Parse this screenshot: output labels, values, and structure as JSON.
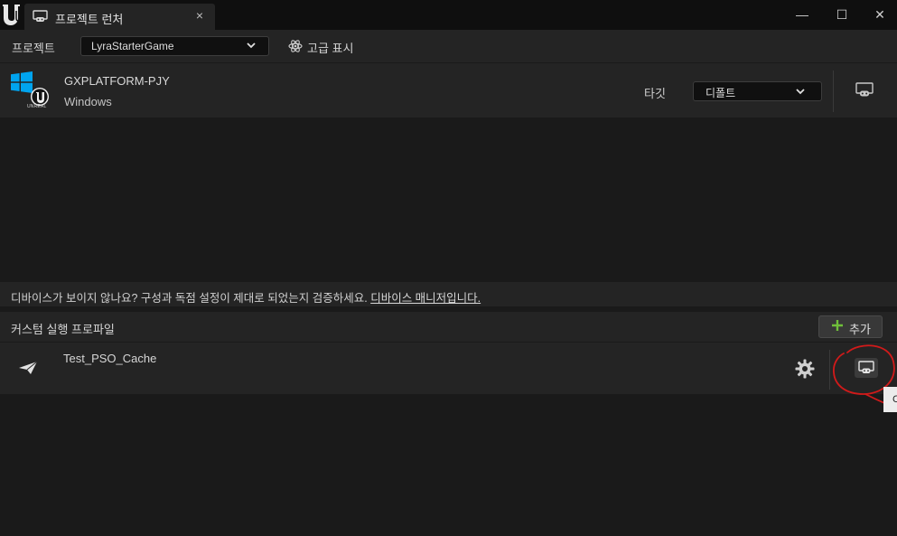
{
  "window": {
    "tab_title": "프로젝트 런처",
    "tab_close": "×",
    "minimize": "—",
    "maximize": "☐",
    "close": "✕"
  },
  "project_bar": {
    "label": "프로젝트",
    "selected_project": "LyraStarterGame",
    "advanced_label": "고급 표시"
  },
  "device": {
    "name": "GXPLATFORM-PJY",
    "os": "Windows",
    "badge_text": "UNREAL",
    "target_label": "타깃",
    "target_value": "디폴트",
    "launch_icon": "gamepad-monitor-icon"
  },
  "hint": {
    "text": "디바이스가 보이지 않나요? 구성과 독점 설정이 제대로 되었는지 검증하세요. ",
    "link": "디바이스 매니저입니다."
  },
  "custom_profiles": {
    "title": "커스텀 실행 프로파일",
    "add_label": "추가",
    "items": [
      {
        "name": "Test_PSO_Cache",
        "icon": "paper-plane-icon"
      }
    ]
  },
  "tooltip": {
    "text": "C"
  },
  "colors": {
    "background": "#1a1a1a",
    "panel": "#242424",
    "titlebar": "#0f0f0f",
    "accent_green": "#6fbf3a",
    "windows_blue": "#00a4ef",
    "annotation_red": "#d11a1a"
  }
}
